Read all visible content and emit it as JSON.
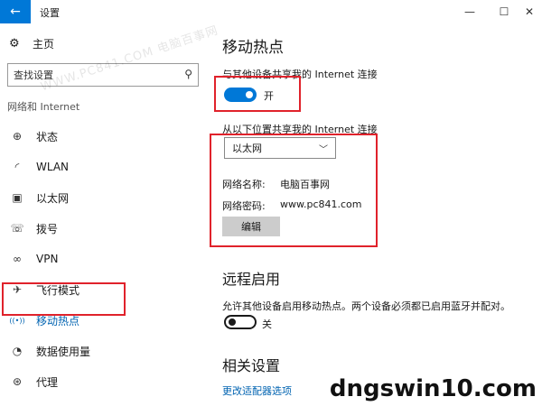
{
  "window": {
    "back_icon": "←",
    "title": "设置",
    "minimize": "—",
    "maximize": "☐",
    "close": "✕"
  },
  "sidebar": {
    "home_icon": "⚙",
    "home": "主页",
    "search_placeholder": "查找设置",
    "search_icon": "⚲",
    "section": "网络和 Internet",
    "items": [
      {
        "icon": "⊕",
        "label": "状态"
      },
      {
        "icon": "◜",
        "label": "WLAN"
      },
      {
        "icon": "▣",
        "label": "以太网"
      },
      {
        "icon": "☏",
        "label": "拨号"
      },
      {
        "icon": "∞",
        "label": "VPN"
      },
      {
        "icon": "✈",
        "label": "飞行模式"
      },
      {
        "icon": "((•))",
        "label": "移动热点"
      },
      {
        "icon": "◔",
        "label": "数据使用量"
      },
      {
        "icon": "⊛",
        "label": "代理"
      }
    ]
  },
  "main": {
    "title": "移动热点",
    "share_label": "与其他设备共享我的 Internet 连接",
    "share_toggle": "开",
    "share_on": true,
    "from_label": "从以下位置共享我的 Internet 连接",
    "from_value": "以太网",
    "chevron": "﹀",
    "network_name_key": "网络名称:",
    "network_name_value": "电脑百事网",
    "network_password_key": "网络密码:",
    "network_password_value": "www.pc841.com",
    "edit_button": "编辑",
    "remote_title": "远程启用",
    "remote_desc": "允许其他设备启用移动热点。两个设备必须都已启用蓝牙并配对。",
    "remote_toggle": "关",
    "remote_on": false,
    "related_title": "相关设置",
    "related_link": "更改适配器选项"
  },
  "watermarks": {
    "top": "WWW.PC841.COM 电脑百事网",
    "bottom": "dngswin10.com"
  },
  "colors": {
    "accent": "#0078d7",
    "highlight_box": "#e0222b",
    "link": "#0063b1"
  }
}
